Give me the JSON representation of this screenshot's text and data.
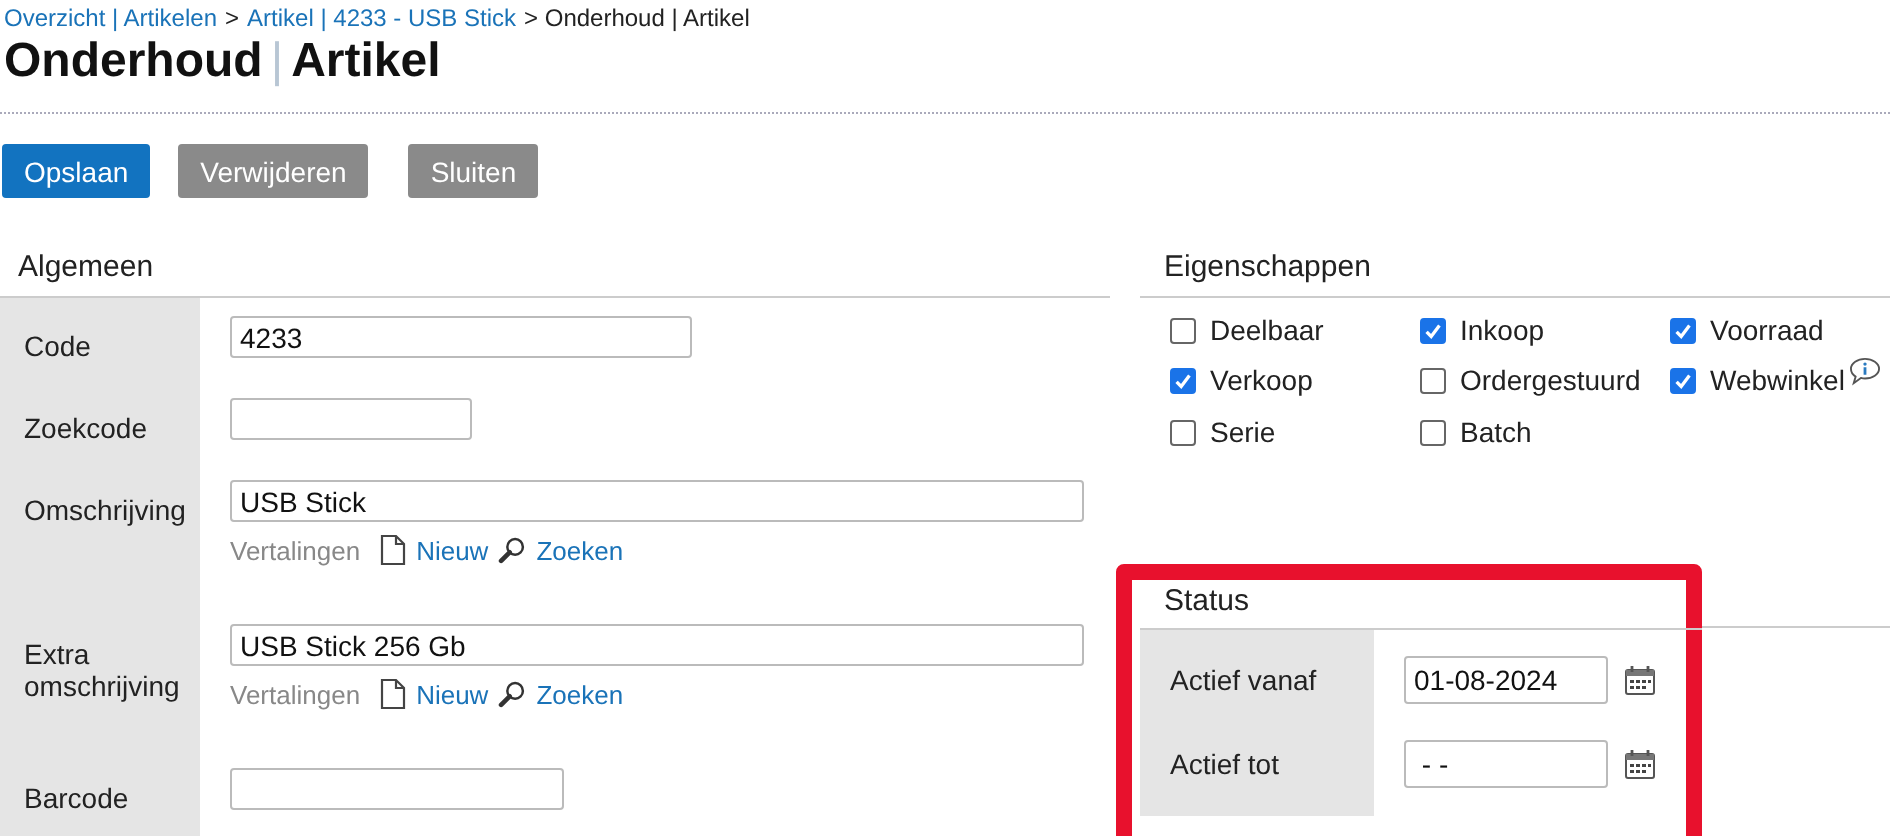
{
  "breadcrumb": [
    {
      "text": "Overzicht | Artikelen",
      "link": true
    },
    {
      "text": ">",
      "link": false
    },
    {
      "text": "Artikel | 4233 - USB Stick",
      "link": true
    },
    {
      "text": "> Onderhoud | Artikel",
      "link": false
    }
  ],
  "title": {
    "main": "Onderhoud",
    "separator": "|",
    "sub": "Artikel"
  },
  "buttons": [
    {
      "label": "Opslaan",
      "primary": true
    },
    {
      "label": "Verwijderen",
      "primary": false
    },
    {
      "label": "Sluiten",
      "primary": false
    }
  ],
  "general": {
    "title": "Algemeen",
    "fields": [
      {
        "label": "Code",
        "value": "4233"
      },
      {
        "label": "Zoekcode"
      },
      {
        "label": "Omschrijving",
        "value": "USB Stick",
        "links": {
          "label": "Vertalingen",
          "new": "Nieuw",
          "search": "Zoeken"
        }
      },
      {
        "label": "Extra omschrijving",
        "value": "USB Stick 256 Gb",
        "links": {
          "label": "Vertalingen",
          "new": "Nieuw",
          "search": "Zoeken"
        }
      },
      {
        "label": "Barcode"
      }
    ]
  },
  "properties": {
    "title": "Eigenschappen",
    "items": [
      {
        "label": "Deelbaar",
        "checked": false
      },
      {
        "label": "Inkoop",
        "checked": true
      },
      {
        "label": "Voorraad",
        "checked": true
      },
      {
        "label": "Verkoop",
        "checked": true
      },
      {
        "label": "Ordergestuurd",
        "checked": false
      },
      {
        "label": "Webwinkel",
        "checked": true,
        "info": true
      },
      {
        "label": "Serie",
        "checked": false
      },
      {
        "label": "Batch",
        "checked": false
      }
    ]
  },
  "status": {
    "title": "Status",
    "highlighted": true,
    "fields": [
      {
        "label": "Actief vanaf",
        "value": "01-08-2024"
      },
      {
        "label": "Actief tot",
        "value": " - -"
      }
    ]
  }
}
